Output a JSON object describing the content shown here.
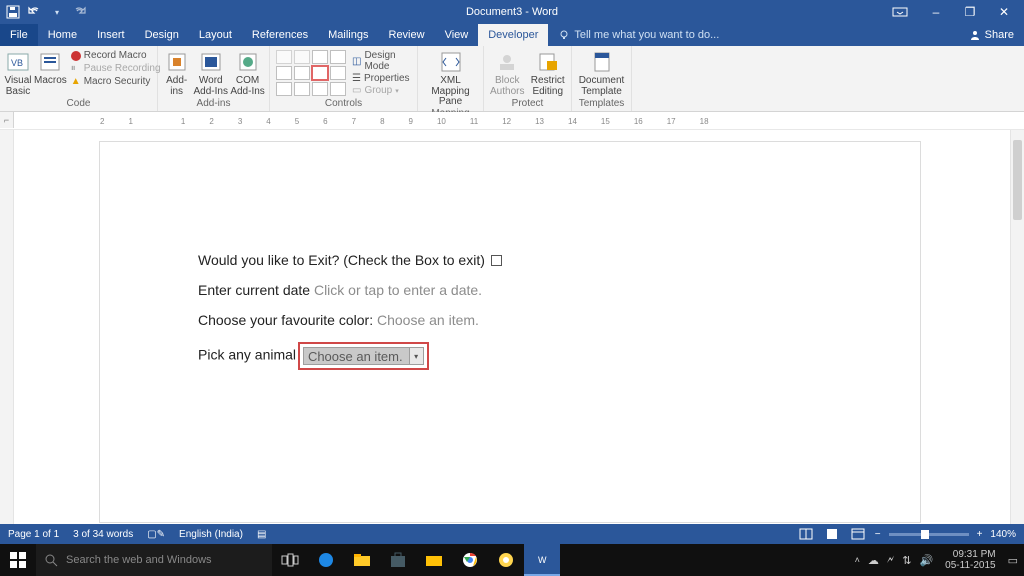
{
  "title": "Document3 - Word",
  "qat": {
    "save": "Save",
    "undo": "Undo",
    "redo": "Redo"
  },
  "win": {
    "opts": "⋯",
    "min": "–",
    "max": "❐",
    "close": "✕"
  },
  "tabs": {
    "file": "File",
    "items": [
      "Home",
      "Insert",
      "Design",
      "Layout",
      "References",
      "Mailings",
      "Review",
      "View",
      "Developer"
    ],
    "active_index": 8,
    "tell": "Tell me what you want to do...",
    "share": "Share"
  },
  "ribbon": {
    "code": {
      "visual_basic": "Visual\nBasic",
      "macros": "Macros",
      "record": "Record Macro",
      "pause": "Pause Recording",
      "security": "Macro Security",
      "group": "Code"
    },
    "addins": {
      "addins": "Add-\nins",
      "word": "Word\nAdd-Ins",
      "com": "COM\nAdd-Ins",
      "group": "Add-ins"
    },
    "controls": {
      "design": "Design Mode",
      "properties": "Properties",
      "group_btn": "Group",
      "group": "Controls"
    },
    "mapping": {
      "xml": "XML Mapping\nPane",
      "group": "Mapping"
    },
    "protect": {
      "block": "Block\nAuthors",
      "restrict": "Restrict\nEditing",
      "group": "Protect"
    },
    "templates": {
      "doc": "Document\nTemplate",
      "group": "Templates"
    }
  },
  "ruler_nums": [
    "2",
    "1",
    "",
    "1",
    "2",
    "3",
    "4",
    "5",
    "6",
    "7",
    "8",
    "9",
    "10",
    "11",
    "12",
    "13",
    "14",
    "15",
    "16",
    "17",
    "18"
  ],
  "doc": {
    "l1a": "Would you like to Exit? (Check the Box to exit) ",
    "l2a": "Enter current date ",
    "l2b": "Click or tap to enter a date.",
    "l3a": "Choose your favourite color: ",
    "l3b": "Choose an item.",
    "l4a": "Pick any animal ",
    "l4b": "Choose an item."
  },
  "status": {
    "page": "Page 1 of 1",
    "words": "3 of 34 words",
    "lang": "English (India)",
    "zoom": "140%"
  },
  "taskbar": {
    "search": "Search the web and Windows",
    "time": "09:31 PM",
    "date": "05-11-2015"
  }
}
